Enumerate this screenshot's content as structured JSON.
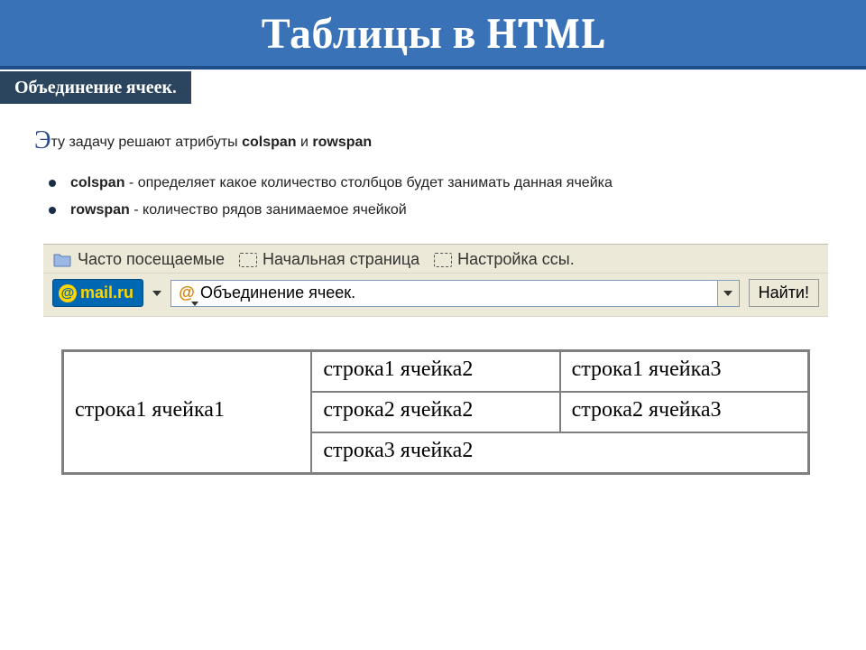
{
  "header": {
    "title": "Таблицы в HTML",
    "subtitle": "Объединение ячеек."
  },
  "intro": {
    "dropcap": "Э",
    "rest_prefix": "ту задачу решают атрибуты ",
    "attr1": "colspan",
    "joiner": " и ",
    "attr2": "rowspan"
  },
  "definitions": [
    {
      "term": "colspan",
      "desc": " - определяет какое количество столбцов будет занимать данная ячейка"
    },
    {
      "term": "rowspan",
      "desc": " - количество рядов занимаемое ячейкой"
    }
  ],
  "browser": {
    "bookmarks": [
      {
        "label": "Часто посещаемые"
      },
      {
        "label": "Начальная страница"
      },
      {
        "label": "Настройка ссы."
      }
    ],
    "mail_logo_text": "mail.ru",
    "search_value": "Объединение ячеек.",
    "find_button": "Найти!"
  },
  "table": {
    "r1c1": "строка1 ячейка1",
    "r1c2": "строка1 ячейка2",
    "r1c3": "строка1 ячейка3",
    "r2c2": "строка2 ячейка2",
    "r2c3": "строка2 ячейка3",
    "r3c2": "строка3 ячейка2"
  }
}
